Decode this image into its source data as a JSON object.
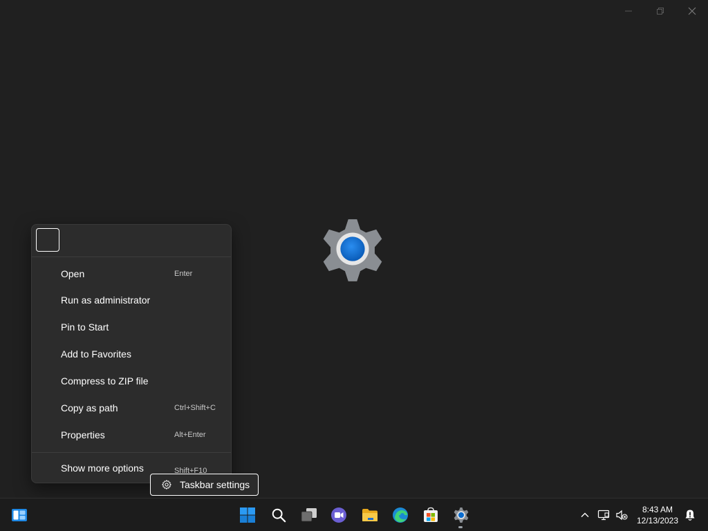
{
  "desktop": {
    "splash_icon": "settings-gear-icon"
  },
  "window_controls": {
    "minimize_icon": "minimize-icon",
    "maximize_icon": "restore-icon",
    "close_icon": "close-icon"
  },
  "context_menu": {
    "items": [
      {
        "label": "Open",
        "shortcut": "Enter"
      },
      {
        "label": "Run as administrator",
        "shortcut": ""
      },
      {
        "label": "Pin to Start",
        "shortcut": ""
      },
      {
        "label": "Add to Favorites",
        "shortcut": ""
      },
      {
        "label": "Compress to ZIP file",
        "shortcut": ""
      },
      {
        "label": "Copy as path",
        "shortcut": "Ctrl+Shift+C"
      },
      {
        "label": "Properties",
        "shortcut": "Alt+Enter"
      }
    ],
    "more": {
      "label": "Show more options",
      "shortcut": "Shift+F10"
    }
  },
  "tooltip": {
    "label": "Taskbar settings",
    "icon": "gear-icon"
  },
  "taskbar": {
    "icons": [
      "widgets-icon",
      "start-icon",
      "search-icon",
      "task-view-icon",
      "teams-chat-icon",
      "file-explorer-icon",
      "edge-icon",
      "store-icon",
      "settings-icon"
    ],
    "tray": [
      "chevron-up-icon",
      "network-icon",
      "volume-muted-icon",
      "notification-icon"
    ],
    "clock": {
      "time": "8:43 AM",
      "date": "12/13/2023"
    }
  },
  "colors": {
    "desktop_bg": "#202020",
    "menu_bg": "#2c2c2c",
    "taskbar_bg": "#1c1c1c",
    "accent_blue": "#0a6ccf"
  }
}
